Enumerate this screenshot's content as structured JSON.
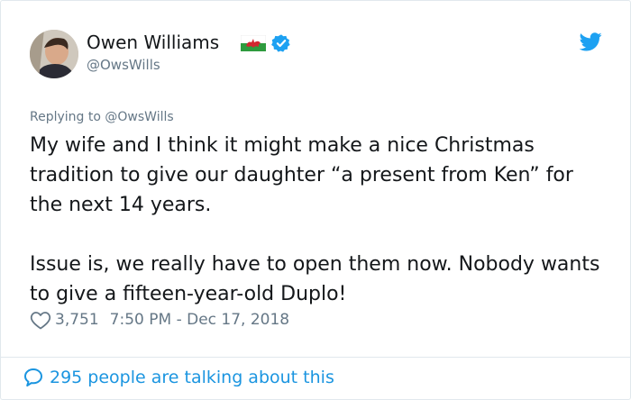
{
  "tweet": {
    "author": {
      "name": "Owen Williams",
      "handle": "@OwsWills",
      "verified": true
    },
    "icons": {
      "flag": "wales-flag-icon",
      "verified": "verified-badge-icon",
      "platform": "twitter-bird-icon",
      "like": "heart-icon",
      "conversation": "speech-bubble-icon"
    },
    "reply": {
      "prefix": "Replying to ",
      "target": "@OwsWills"
    },
    "text": {
      "paragraph1": "My wife and I think it might make a nice Christmas tradition to give our daughter “a present from Ken” for the next 14 years.",
      "paragraph2": "Issue is, we really have to open them now. Nobody wants to give a fifteen-year-old Duplo!"
    },
    "meta": {
      "likes": "3,751",
      "timestamp": "7:50 PM - Dec 17, 2018"
    },
    "footer": {
      "talking": "295 people are talking about this"
    }
  },
  "colors": {
    "text": "#14171a",
    "secondary": "#657786",
    "accent": "#1b95e0",
    "verified": "#1da1f2",
    "border": "#e1e8ed"
  }
}
